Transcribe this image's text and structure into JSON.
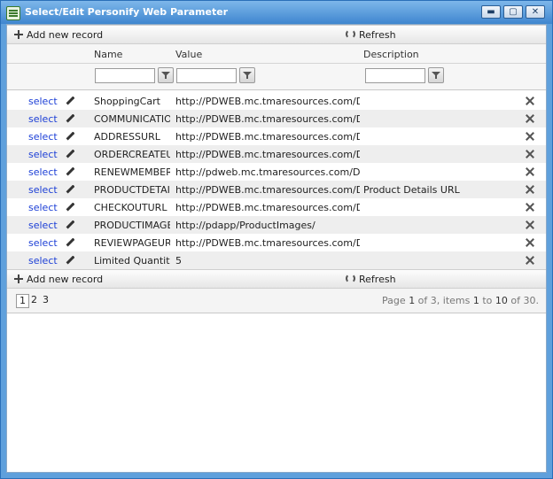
{
  "window": {
    "title": "Select/Edit Personify Web Parameter",
    "minimize": "▬",
    "maximize": "▢",
    "close": "✕"
  },
  "toolbar": {
    "add_label": "Add new record",
    "refresh_label": "Refresh"
  },
  "columns": {
    "name": "Name",
    "value": "Value",
    "description": "Description"
  },
  "rows": [
    {
      "select": "select",
      "name": "ShoppingCart",
      "value": "http://PDWEB.mc.tmaresources.com/DEMO_O",
      "description": ""
    },
    {
      "select": "select",
      "name": "COMMUNICATION",
      "value": "http://PDWEB.mc.tmaresources.com/DEMO_O",
      "description": ""
    },
    {
      "select": "select",
      "name": "ADDRESSURL",
      "value": "http://PDWEB.mc.tmaresources.com/DEMO_O",
      "description": ""
    },
    {
      "select": "select",
      "name": "ORDERCREATEURL",
      "value": "http://PDWEB.mc.tmaresources.com/DEMO_O",
      "description": ""
    },
    {
      "select": "select",
      "name": "RENEWMEMBERSHI",
      "value": "http://pdweb.mc.tmaresources.com/DEMO_OL",
      "description": ""
    },
    {
      "select": "select",
      "name": "PRODUCTDETAILS",
      "value": "http://PDWEB.mc.tmaresources.com/DEMO_O",
      "description": "Product Details URL"
    },
    {
      "select": "select",
      "name": "CHECKOUTURL",
      "value": "http://PDWEB.mc.tmaresources.com/DEMO_O",
      "description": ""
    },
    {
      "select": "select",
      "name": "PRODUCTIMAGES",
      "value": "http://pdapp/ProductImages/",
      "description": ""
    },
    {
      "select": "select",
      "name": "REVIEWPAGEURL",
      "value": "http://PDWEB.mc.tmaresources.com/DEMO_O",
      "description": ""
    },
    {
      "select": "select",
      "name": "Limited Quantity",
      "value": "5",
      "description": ""
    }
  ],
  "pager": {
    "pages": [
      "1",
      "2",
      "3"
    ],
    "info": {
      "page_label": "Page ",
      "page": "1",
      "of_label": " of 3, items ",
      "from": "1",
      "to_label": " to ",
      "to": "10",
      "total_label": " of 30."
    }
  }
}
